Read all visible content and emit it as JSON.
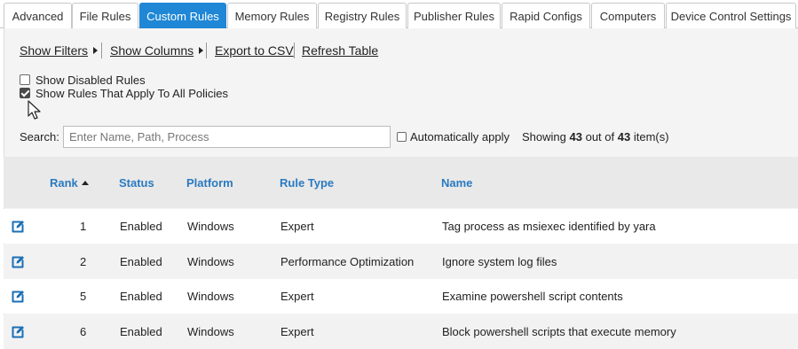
{
  "tabs": [
    {
      "label": "Advanced",
      "active": false
    },
    {
      "label": "File Rules",
      "active": false
    },
    {
      "label": "Custom Rules",
      "active": true
    },
    {
      "label": "Memory Rules",
      "active": false
    },
    {
      "label": "Registry Rules",
      "active": false
    },
    {
      "label": "Publisher Rules",
      "active": false
    },
    {
      "label": "Rapid Configs",
      "active": false
    },
    {
      "label": "Computers",
      "active": false
    },
    {
      "label": "Device Control Settings",
      "active": false
    }
  ],
  "toolbar": {
    "show_filters": "Show Filters",
    "show_columns": "Show Columns",
    "export_csv": "Export to CSV",
    "refresh_table": "Refresh Table"
  },
  "options": {
    "show_disabled": {
      "label": "Show Disabled Rules",
      "checked": false
    },
    "show_all_policies": {
      "label": "Show Rules That Apply To All Policies",
      "checked": true
    }
  },
  "search": {
    "label": "Search:",
    "placeholder": "Enter Name, Path, Process",
    "value": "",
    "auto_apply_label": "Automatically apply",
    "auto_apply_checked": false
  },
  "count": {
    "prefix": "Showing",
    "shown": "43",
    "middle": "out of",
    "total": "43",
    "suffix": "item(s)"
  },
  "table": {
    "columns": {
      "rank": "Rank",
      "status": "Status",
      "platform": "Platform",
      "rule_type": "Rule Type",
      "name": "Name"
    },
    "sort": {
      "column": "rank",
      "direction": "ascending"
    },
    "rows": [
      {
        "rank": "1",
        "status": "Enabled",
        "platform": "Windows",
        "rule_type": "Expert",
        "name": "Tag process as msiexec identified by yara"
      },
      {
        "rank": "2",
        "status": "Enabled",
        "platform": "Windows",
        "rule_type": "Performance Optimization",
        "name": "Ignore system log files"
      },
      {
        "rank": "5",
        "status": "Enabled",
        "platform": "Windows",
        "rule_type": "Expert",
        "name": "Examine powershell script contents"
      },
      {
        "rank": "6",
        "status": "Enabled",
        "platform": "Windows",
        "rule_type": "Expert",
        "name": "Block powershell scripts that execute memory"
      }
    ]
  },
  "colors": {
    "accent": "#1f87d6",
    "header_text": "#2a7ac0",
    "edit_icon": "#1a6fb5"
  },
  "icons": {
    "row_edit": "edit-icon",
    "filters_caret": "caret-right-icon",
    "sort": "sort-ascending-icon",
    "cursor": "mouse-pointer-icon"
  }
}
